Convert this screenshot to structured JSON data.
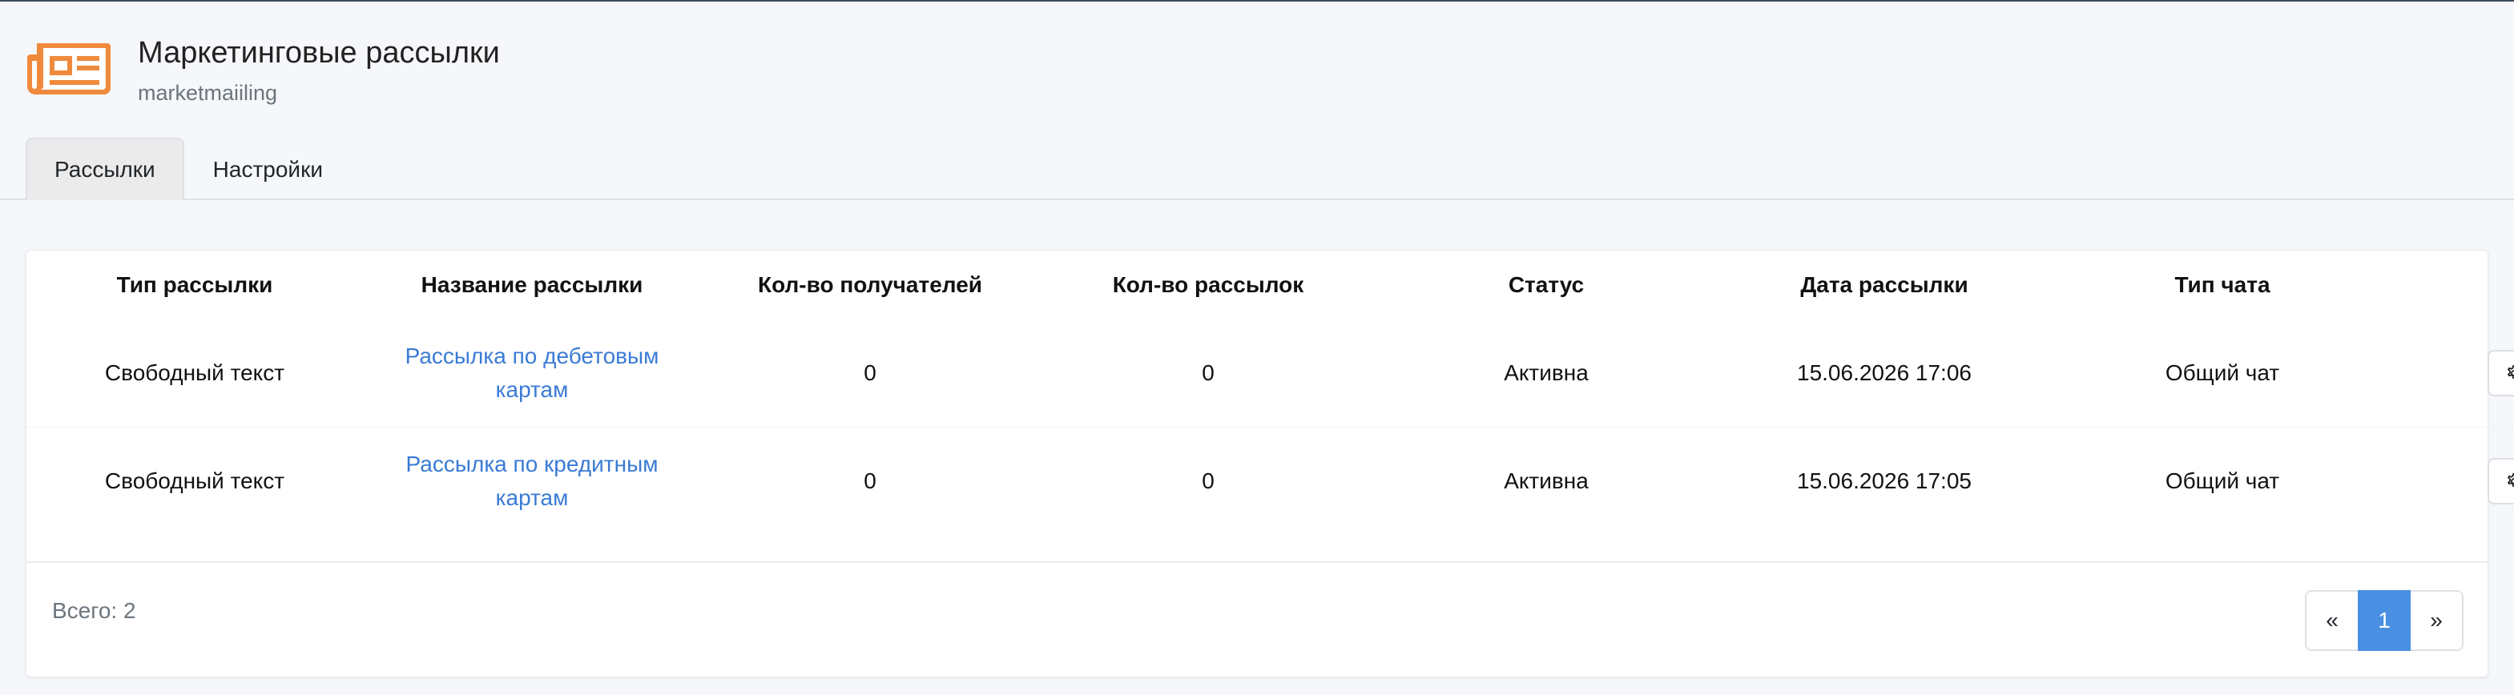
{
  "header": {
    "title": "Маркетинговые рассылки",
    "subtitle": "marketmaiiling",
    "icon": "newspaper-icon",
    "accent_color": "#ef8a3c"
  },
  "tabs": [
    {
      "label": "Рассылки",
      "active": true
    },
    {
      "label": "Настройки",
      "active": false
    }
  ],
  "table": {
    "columns": [
      "Тип рассылки",
      "Название рассылки",
      "Кол-во получателей",
      "Кол-во рассылок",
      "Статус",
      "Дата рассылки",
      "Тип чата"
    ],
    "rows": [
      {
        "type": "Свободный текст",
        "name": "Рассылка по дебетовым картам",
        "recipients": "0",
        "count": "0",
        "status": "Активна",
        "date": "15.06.2026 17:06",
        "chat_type": "Общий чат",
        "action_icon": "gear-icon"
      },
      {
        "type": "Свободный текст",
        "name": "Рассылка по кредитным картам",
        "recipients": "0",
        "count": "0",
        "status": "Активна",
        "date": "15.06.2026 17:05",
        "chat_type": "Общий чат",
        "action_icon": "gear-icon"
      }
    ]
  },
  "footer": {
    "total": "Всего: 2"
  },
  "pagination": {
    "prev": "«",
    "current": "1",
    "next": "»",
    "active_color": "#4a90e2"
  },
  "colors": {
    "link": "#3a7bd5",
    "background": "#f5f7fa"
  }
}
